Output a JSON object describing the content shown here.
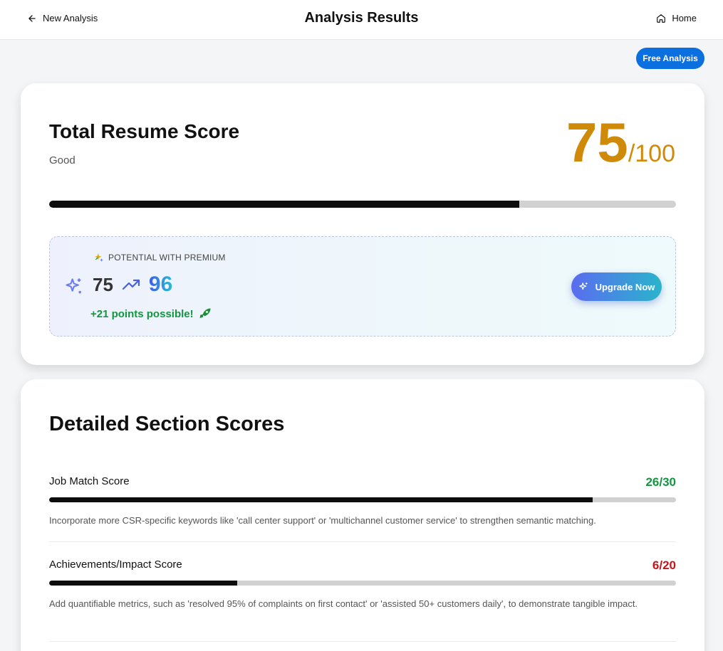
{
  "header": {
    "back_label": "New Analysis",
    "title": "Analysis Results",
    "home_label": "Home"
  },
  "free_analysis_label": "Free Analysis",
  "total_score": {
    "title": "Total Resume Score",
    "rating": "Good",
    "score": "75",
    "max": "/100",
    "fraction": 0.75,
    "score_color": "#d08a0a"
  },
  "premium": {
    "label": "POTENTIAL WITH PREMIUM",
    "current": "75",
    "potential": "96",
    "points_text": "+21 points possible!",
    "upgrade_label": "Upgrade Now"
  },
  "sections": {
    "title": "Detailed Section Scores",
    "items": [
      {
        "name": "Job Match Score",
        "value": "26/30",
        "fraction": 0.867,
        "color": "#12963f",
        "description": "Incorporate more CSR-specific keywords like 'call center support' or 'multichannel customer service' to strengthen semantic matching."
      },
      {
        "name": "Achievements/Impact Score",
        "value": "6/20",
        "fraction": 0.3,
        "color": "#c8151b",
        "description": "Add quantifiable metrics, such as 'resolved 95% of complaints on first contact' or 'assisted 50+ customers daily', to demonstrate tangible impact."
      }
    ]
  }
}
